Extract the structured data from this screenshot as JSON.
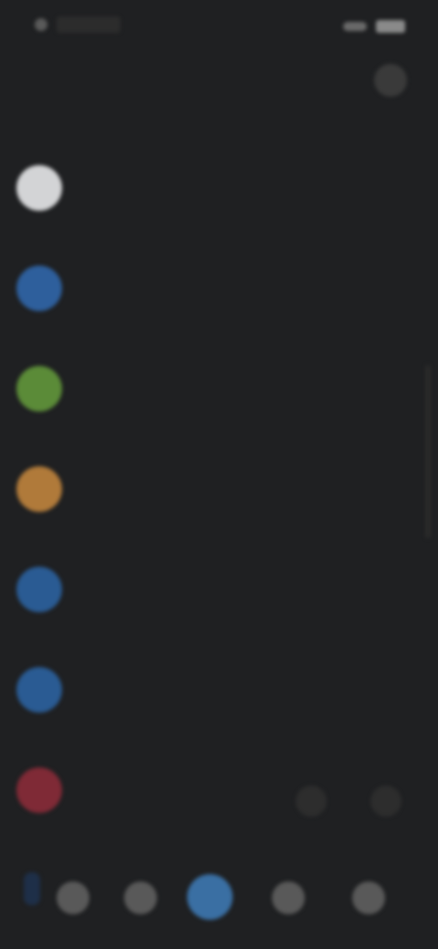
{
  "status_bar": {
    "left_icons": [
      "status-icon"
    ],
    "right_icons": [
      "wifi-icon",
      "battery-icon"
    ]
  },
  "header": {
    "tab_1": "",
    "tab_2": "",
    "search_icon": "search-icon"
  },
  "contacts": [
    {
      "name": "",
      "avatar_color": "#d3d4d6"
    },
    {
      "name": "",
      "avatar_color": "#2e5f9c"
    },
    {
      "name": "",
      "avatar_color": "#5b8b38"
    },
    {
      "name": "",
      "avatar_color": "#b07a3a"
    },
    {
      "name": "",
      "avatar_color": "#2a5b93"
    },
    {
      "name": "",
      "avatar_color": "#2a5b93"
    },
    {
      "name": "",
      "avatar_color": "#7f2a36",
      "sub": ""
    }
  ],
  "bottom_nav": {
    "items": [
      "nav-item-1",
      "nav-item-2",
      "nav-item-center",
      "nav-item-4",
      "nav-item-5"
    ],
    "accent_color": "#3a6fa3"
  }
}
